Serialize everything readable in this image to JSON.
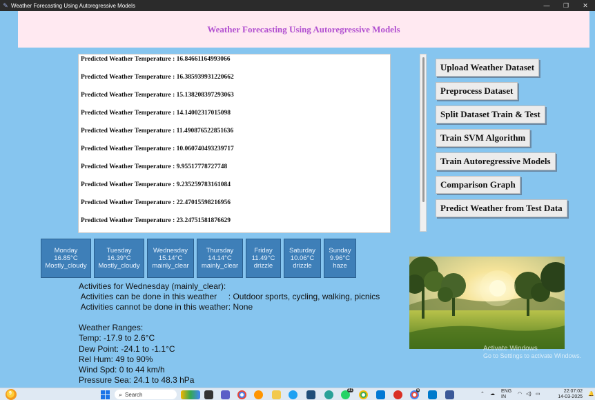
{
  "window": {
    "title": "Weather Forecasting Using Autoregressive Models"
  },
  "header": {
    "title": "Weather Forecasting Using Autoregressive Models"
  },
  "output": {
    "lines": [
      "Predicted Weather Temperature : 16.84661164993066",
      "Predicted Weather Temperature : 16.385939931220662",
      "Predicted Weather Temperature : 15.138208397293063",
      "Predicted Weather Temperature : 14.14002317015098",
      "Predicted Weather Temperature : 11.490876522851636",
      "Predicted Weather Temperature : 10.060740493239717",
      "Predicted Weather Temperature : 9.95517778727748",
      "Predicted Weather Temperature : 9.235259783161084",
      "Predicted Weather Temperature : 22.47015598216956",
      "Predicted Weather Temperature : 23.24751581876629"
    ]
  },
  "buttons": {
    "upload": "Upload Weather Dataset",
    "preprocess": "Preprocess Dataset",
    "split": "Split Dataset Train & Test",
    "svm": "Train SVM Algorithm",
    "autoregressive": "Train Autoregressive Models",
    "comparison": "Comparison Graph",
    "predict": "Predict Weather from Test Data"
  },
  "forecast": [
    {
      "day": "Monday",
      "temp": "16.85°C",
      "cond": "Mostly_cloudy"
    },
    {
      "day": "Tuesday",
      "temp": "16.39°C",
      "cond": "Mostly_cloudy"
    },
    {
      "day": "Wednesday",
      "temp": "15.14°C",
      "cond": "mainly_clear"
    },
    {
      "day": "Thursday",
      "temp": "14.14°C",
      "cond": "mainly_clear"
    },
    {
      "day": "Friday",
      "temp": "11.49°C",
      "cond": "drizzle"
    },
    {
      "day": "Saturday",
      "temp": "10.06°C",
      "cond": "drizzle"
    },
    {
      "day": "Sunday",
      "temp": "9.96°C",
      "cond": "haze"
    }
  ],
  "activities": {
    "heading": "Activities for Wednesday (mainly_clear):",
    "can_do": " Activities can be done in this weather     : Outdoor sports, cycling, walking, picnics",
    "cannot_do": " Activities cannot be done in this weather: None"
  },
  "ranges": {
    "heading": "Weather Ranges:",
    "temp": "Temp: -17.9 to 2.6°C",
    "dew": "Dew Point: -24.1 to -1.1°C",
    "hum": "Rel Hum: 49 to 90%",
    "wind": "Wind Spd: 0 to 44 km/h",
    "pressure": "Pressure Sea: 24.1 to 48.3 hPa"
  },
  "watermark": {
    "line1": "Activate Windows",
    "line2": "Go to Settings to activate Windows."
  },
  "taskbar": {
    "search_placeholder": "Search",
    "lang": "ENG",
    "region": "IN",
    "time": "22:07:02",
    "date": "14-03-2025",
    "badges": [
      "31",
      "6"
    ],
    "weather_badge": "9"
  },
  "colors": {
    "background": "#86c5ef",
    "header_bg": "#ffe9f1",
    "header_text": "#b14fd0",
    "day_card": "#3e7fb8"
  }
}
